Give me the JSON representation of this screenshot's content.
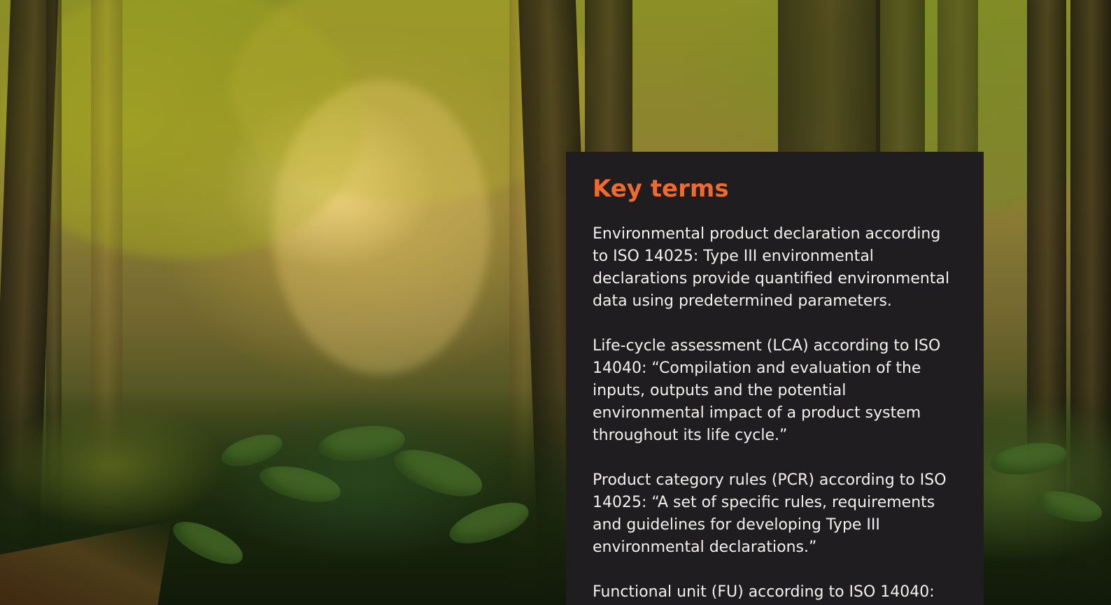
{
  "background": {
    "image_subject": "forest",
    "image_description": "sunlit forest with green leaves, trunks and undergrowth",
    "colors": {
      "panel": "#201d20",
      "accent": "#ef6a2c",
      "text": "#f4f1ec"
    }
  },
  "key_terms": {
    "title": "Key terms",
    "items": [
      {
        "text": "Environmental product declaration according to ISO 14025: Type III environmental declarations provide quantified environmental data using predetermined parameters."
      },
      {
        "text": "Life-cycle assessment (LCA) according to ISO 14040: “Compilation and evaluation of the inputs, outputs and the potential environmental impact of a product system throughout its life cycle.”"
      },
      {
        "text": "Product category rules (PCR) according to ISO 14025: “A set of specific rules, requirements and guidelines for developing Type III environmental declarations.”"
      },
      {
        "text": "Functional unit (FU) according to ISO 14040:"
      }
    ]
  }
}
